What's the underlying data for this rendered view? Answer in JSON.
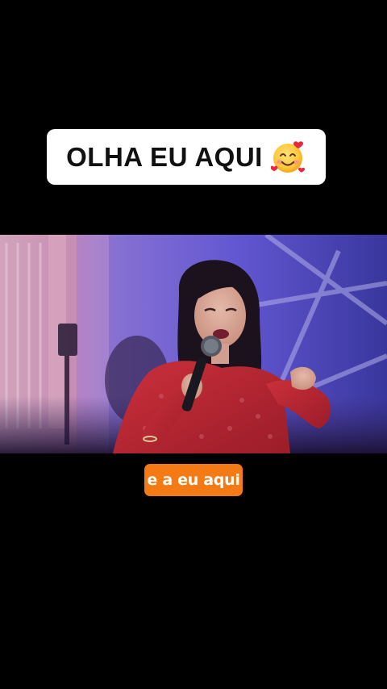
{
  "overlay": {
    "title_text": "OLHA EU AQUI",
    "title_emoji": "smiling-face-with-hearts-icon",
    "caption_text": "e a eu aqui"
  },
  "video": {
    "scene": "singer-on-stage",
    "colors": {
      "background": "#000000",
      "caption_accent": "#f47a16",
      "dress": "#c42a35",
      "stage_light": "#5b4fd6"
    }
  }
}
